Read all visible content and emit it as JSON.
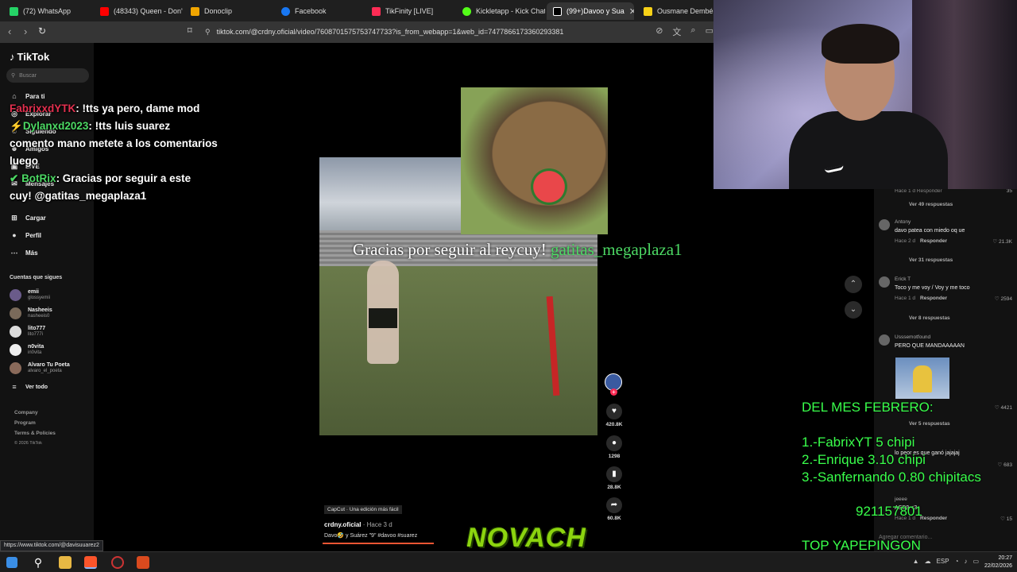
{
  "browser": {
    "tabs": [
      {
        "label": "(72) WhatsApp",
        "color": "#25d366"
      },
      {
        "label": "(48343) Queen - Don't",
        "color": "#ff0000"
      },
      {
        "label": "Donoclip",
        "color": "#f0a500"
      },
      {
        "label": "Facebook",
        "color": "#1877f2"
      },
      {
        "label": "TikFinity [LIVE]",
        "color": "#fe2c55"
      },
      {
        "label": "Kickletapp - Kick Chat",
        "color": "#53fc18"
      },
      {
        "label": "(99+)Davoo y Sua",
        "color": "#000000",
        "close": "✕"
      },
      {
        "label": "Ousmane Dembélé e",
        "color": "#f7d117"
      }
    ],
    "url": "tiktok.com/@crdny.oficial/video/7608701575753747733?is_from_webapp=1&web_id=7477866173360293381",
    "status_url": "https://www.tiktok.com/@davisuuarez2"
  },
  "tiktok": {
    "brand": "TikTok",
    "search_placeholder": "Buscar",
    "nav": [
      "Para ti",
      "Explorar",
      "Siguiendo",
      "Amigos",
      "LIVE",
      "Mensajes",
      "Cargar",
      "Perfil",
      "Más"
    ],
    "following_header": "Cuentas que sigues",
    "following": [
      {
        "name": "emii",
        "handle": "glossyemii"
      },
      {
        "name": "Nasheeis",
        "handle": "nasheeis0"
      },
      {
        "name": "lito777",
        "handle": "lito777i"
      },
      {
        "name": "n0vita",
        "handle": "in0vita"
      },
      {
        "name": "Alvaro Tu Poeta",
        "handle": "alvaro_el_poeta"
      }
    ],
    "see_all": "Ver todo",
    "footer": [
      "Company",
      "Program",
      "Terms & Policies",
      "© 2026 TikTok"
    ]
  },
  "chat": [
    {
      "user": "FabrixxdYTK",
      "msg": ": !tts ya pero, dame mod"
    },
    {
      "user": "Dylanxd2023",
      "msg": ": !tts luis suarez"
    },
    {
      "user": "",
      "msg": "comento mano metete a los comentarios"
    },
    {
      "user": "",
      "msg": "luego"
    },
    {
      "user": "BotRix",
      "msg": ": Gracias por seguir a este"
    },
    {
      "user": "",
      "msg": "cuy! @gatitas_megaplaza1"
    }
  ],
  "overlay": {
    "follow_text": "Gracias por seguir al reycuy!",
    "follow_user": "gatitas_megaplaza1",
    "novach": "NOVACH"
  },
  "video": {
    "capcut": "CapCut · Una edición más fácil",
    "author": "crdny.oficial",
    "ago": "· Hace 3 d",
    "description": "Davo🤣 y Suárez \"9\" #davoo #suarez",
    "likes": "420.8K",
    "comments": "1298",
    "saves": "28.8K",
    "shares": "60.8K"
  },
  "comments": [
    {
      "top": "Hace 1 d  Responder",
      "likes": "35"
    },
    {
      "more": "Ver 49 respuestas"
    },
    {
      "name": "Antony",
      "text": "davo patea con miedo oq ue",
      "meta": "Hace 2 d",
      "reply": "Responder",
      "likes": "21.3K"
    },
    {
      "more": "Ver 31 respuestas"
    },
    {
      "name": "Erick T",
      "text": "Toco y me voy / Voy y me toco",
      "meta": "Hace 1 d",
      "reply": "Responder",
      "likes": "2594"
    },
    {
      "more": "Ver 8 respuestas"
    },
    {
      "name": "Usssemotfound",
      "text": "PERO QUE MANDAAAAAN",
      "meta": "",
      "reply": "",
      "likes": "4421"
    },
    {
      "more": "Ver 5 respuestas"
    },
    {
      "name": "",
      "text": "lo peor es que ganó jajajaj",
      "meta": "Hace 1 d",
      "reply": "",
      "likes": "683"
    },
    {
      "name": "jeeee",
      "text": "ASD9 <3",
      "meta": "Hace 1 d",
      "reply": "Responder",
      "likes": "15"
    },
    {
      "placeholder": "Agregar comentario..."
    }
  ],
  "leaderboard": {
    "title": "DEL MES FEBRERO:",
    "lines": [
      "1.-FabrixYT 5 chipi",
      "2.-Enrique 3.10 chipi",
      "3.-Sanfernando 0.80 chipitacs"
    ],
    "number": "921157801",
    "footer": "TOP YAPEPINGON"
  },
  "taskbar": {
    "time": "20:27",
    "date": "22/02/2026"
  }
}
